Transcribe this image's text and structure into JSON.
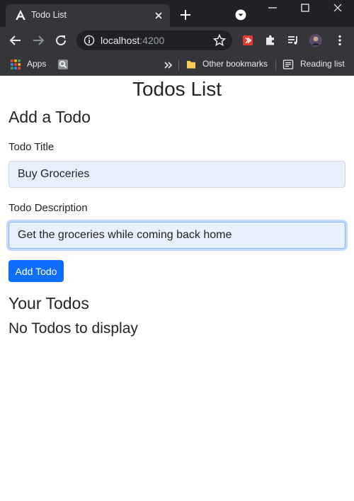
{
  "browser": {
    "tab": {
      "title": "Todo List",
      "favicon": "angular-logo-icon"
    },
    "address": {
      "host": "localhost",
      "port": ":4200"
    },
    "bookmarks": {
      "apps_label": "Apps",
      "other_bookmarks_label": "Other bookmarks",
      "reading_list_label": "Reading list"
    },
    "theme": {
      "frame": "#202124",
      "toolbar": "#35363a",
      "text": "#e8eaed"
    }
  },
  "page": {
    "title": "Todos List",
    "add_section": {
      "heading": "Add a Todo",
      "title_label": "Todo Title",
      "title_value": "Buy Groceries",
      "description_label": "Todo Description",
      "description_value": "Get the groceries while coming back home",
      "submit_label": "Add Todo"
    },
    "list_section": {
      "heading": "Your Todos",
      "empty_message": "No Todos to display"
    },
    "colors": {
      "primary": "#0d6efd",
      "input_bg": "#e8f0fe",
      "text": "#212529"
    }
  }
}
